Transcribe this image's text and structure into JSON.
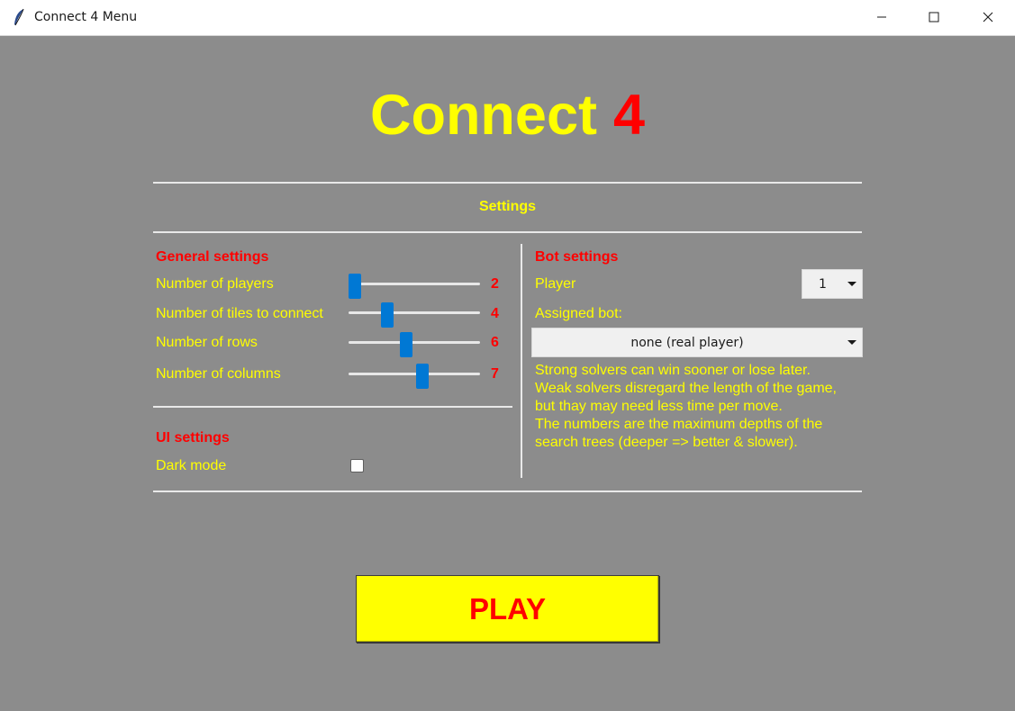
{
  "window": {
    "title": "Connect 4 Menu",
    "icons": [
      "feather-icon",
      "minimize-icon",
      "maximize-icon",
      "close-icon"
    ]
  },
  "heading": {
    "word1": "Connect",
    "word2": "4"
  },
  "settings": {
    "title": "Settings",
    "general": {
      "title": "General settings",
      "sliders": [
        {
          "label": "Number of players",
          "value": "2",
          "position": 0.0
        },
        {
          "label": "Number of tiles to connect",
          "value": "4",
          "position": 0.27
        },
        {
          "label": "Number of rows",
          "value": "6",
          "position": 0.43
        },
        {
          "label": "Number of columns",
          "value": "7",
          "position": 0.57
        }
      ]
    },
    "ui": {
      "title": "UI settings",
      "dark_mode_label": "Dark mode",
      "dark_mode_checked": false
    },
    "bot": {
      "title": "Bot settings",
      "player_label": "Player",
      "player_value": "1",
      "assigned_label": "Assigned bot:",
      "assigned_value": "none (real player)",
      "description": [
        "Strong solvers can win sooner or lose later.",
        "Weak solvers disregard the length of the game,",
        "but thay may need less time per move.",
        "The numbers are the maximum depths of the",
        "search trees (deeper => better & slower)."
      ]
    }
  },
  "play_button": {
    "label": "PLAY"
  },
  "colors": {
    "background": "#8c8c8c",
    "title_yellow": "#ffff00",
    "accent_red": "#ff0000",
    "slider_blue": "#0078d4"
  }
}
